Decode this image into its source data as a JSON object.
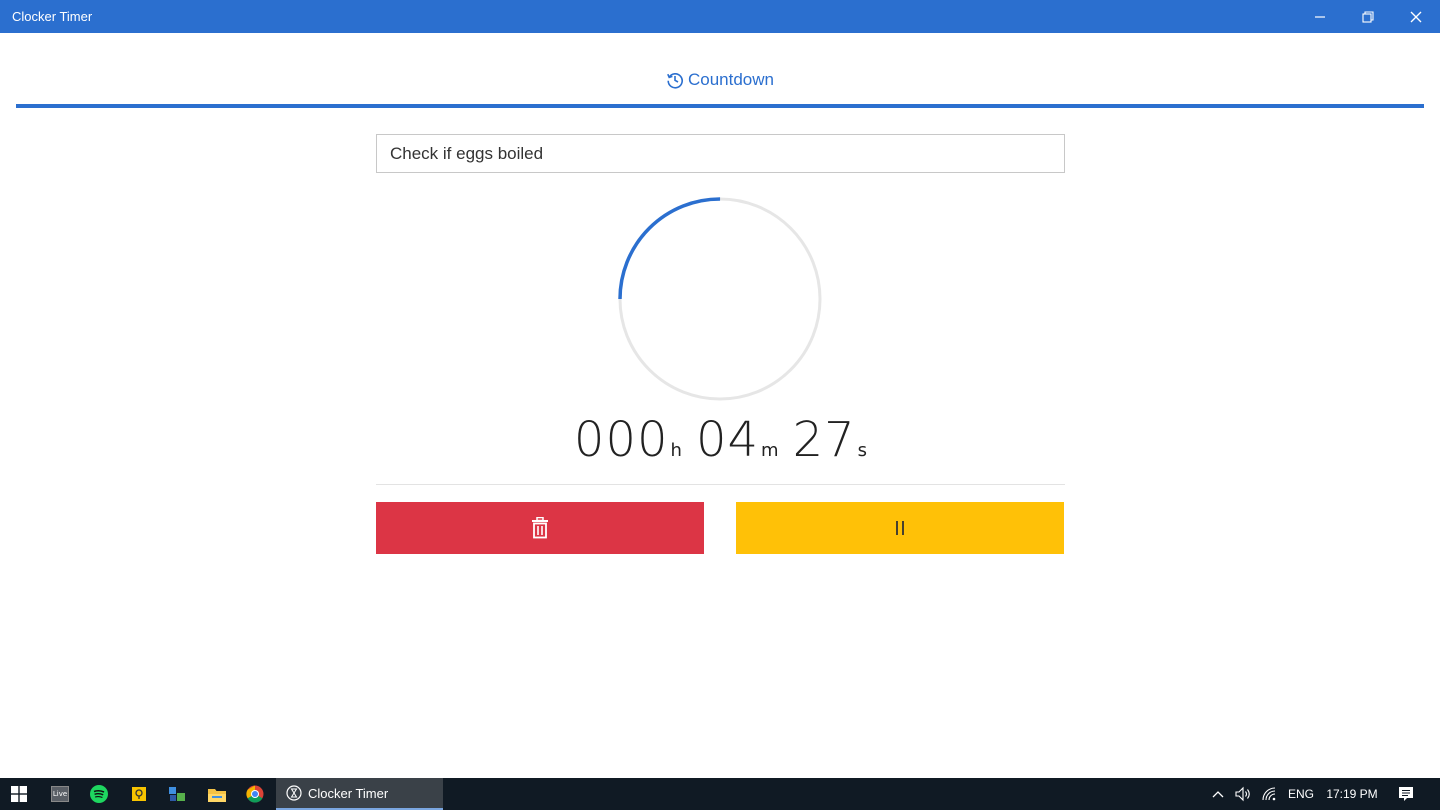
{
  "window": {
    "title": "Clocker Timer",
    "controls": {
      "minimize": "minimize-icon",
      "restore": "restore-icon",
      "close": "close-icon"
    }
  },
  "tabs": [
    {
      "label": "Countdown",
      "icon": "history-icon",
      "active": true
    }
  ],
  "timer": {
    "name": "Check if eggs boiled",
    "hours": "000",
    "hours_unit": "h",
    "minutes": "04",
    "minutes_unit": "m",
    "seconds": "27",
    "seconds_unit": "s",
    "progress_fraction": 0.25
  },
  "actions": {
    "delete_icon": "trash-icon",
    "pause_icon": "pause-icon"
  },
  "colors": {
    "accent": "#2b6fcf",
    "delete": "#dc3545",
    "pause": "#ffc107",
    "ring_track": "#e6e6e6"
  },
  "taskbar": {
    "pinned": [
      "windows-start-icon",
      "live-icon",
      "spotify-icon",
      "sticky-notes-icon",
      "app-icon",
      "file-explorer-icon",
      "chrome-icon"
    ],
    "live_label": "Live",
    "active_app": "Clocker Timer",
    "tray": {
      "language": "ENG",
      "time": "17:19 PM"
    }
  }
}
